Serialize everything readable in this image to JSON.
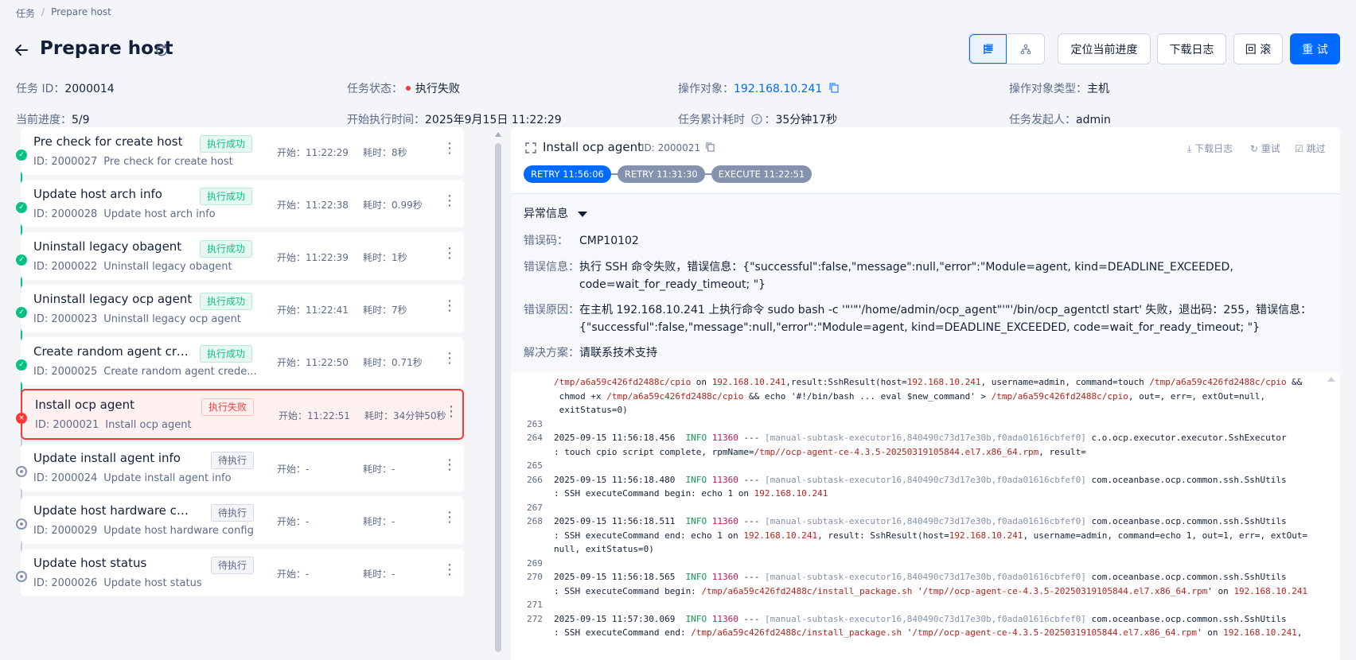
{
  "breadcrumb": {
    "root": "任务",
    "separator": "/",
    "current": "Prepare host"
  },
  "header": {
    "title": "Prepare host"
  },
  "toolbar": {
    "locate_label": "定位当前进度",
    "download_label": "下载日志",
    "rollback_label": "回 滚",
    "retry_label": "重 试"
  },
  "info": {
    "task_id_label": "任务 ID：",
    "task_id": "2000014",
    "status_label": "任务状态：",
    "status": "执行失败",
    "target_label": "操作对象：",
    "target": "192.168.10.241",
    "target_type_label": "操作对象类型：",
    "target_type": "主机",
    "progress_label": "当前进度：",
    "progress": "5/9",
    "start_label": "开始执行时间：",
    "start": "2025年9月15日 11:22:29",
    "elapsed_label": "任务累计耗时",
    "elapsed": "35分钟17秒",
    "initiator_label": "任务发起人：",
    "initiator": "admin"
  },
  "steps": [
    {
      "name": "Pre check for create host",
      "id_line": "ID: 2000027",
      "desc": "Pre check for create host",
      "status": "执行成功",
      "state": "ok",
      "start": "开始：11:22:29",
      "dur": "耗时：8秒"
    },
    {
      "name": "Update host arch info",
      "id_line": "ID: 2000028",
      "desc": "Update host arch info",
      "status": "执行成功",
      "state": "ok",
      "start": "开始：11:22:38",
      "dur": "耗时：0.99秒"
    },
    {
      "name": "Uninstall legacy obagent",
      "id_line": "ID: 2000022",
      "desc": "Uninstall legacy obagent",
      "status": "执行成功",
      "state": "ok",
      "start": "开始：11:22:39",
      "dur": "耗时：1秒"
    },
    {
      "name": "Uninstall legacy ocp agent",
      "id_line": "ID: 2000023",
      "desc": "Uninstall legacy ocp agent",
      "status": "执行成功",
      "state": "ok",
      "start": "开始：11:22:41",
      "dur": "耗时：7秒"
    },
    {
      "name": "Create random agent crede…",
      "id_line": "ID: 2000025",
      "desc": "Create random agent crede...",
      "status": "执行成功",
      "state": "ok",
      "start": "开始：11:22:50",
      "dur": "耗时：0.71秒"
    },
    {
      "name": "Install ocp agent",
      "id_line": "ID: 2000021",
      "desc": "Install ocp agent",
      "status": "执行失败",
      "state": "bad",
      "start": "开始：11:22:51",
      "dur": "耗时：34分钟50秒"
    },
    {
      "name": "Update install agent info",
      "id_line": "ID: 2000024",
      "desc": "Update install agent info",
      "status": "待执行",
      "state": "wait",
      "start": "开始：-",
      "dur": "耗时：-"
    },
    {
      "name": "Update host hardware config",
      "id_line": "ID: 2000029",
      "desc": "Update host hardware config",
      "status": "待执行",
      "state": "wait",
      "start": "开始：-",
      "dur": "耗时：-"
    },
    {
      "name": "Update host status",
      "id_line": "ID: 2000026",
      "desc": "Update host status",
      "status": "待执行",
      "state": "wait",
      "start": "开始：-",
      "dur": "耗时：-"
    }
  ],
  "detail": {
    "title": "Install ocp agent",
    "id": "ID: 2000021",
    "download": "下载日志",
    "retry": "重试",
    "skip": "跳过",
    "runs": [
      "RETRY 11:56:06",
      "RETRY 11:31:30",
      "EXECUTE 11:22:51"
    ],
    "error_section": "异常信息",
    "code_label": "错误码：",
    "code": "CMP10102",
    "msg_label": "错误信息：",
    "msg": "执行 SSH 命令失败，错误信息：{\"successful\":false,\"message\":null,\"error\":\"Module=agent, kind=DEADLINE_EXCEEDED, code=wait_for_ready_timeout; \"}",
    "reason_label": "错误原因：",
    "reason": "在主机 192.168.10.241 上执行命令 sudo bash -c '\"'\"'/home/admin/ocp_agent\"'\"'/bin/ocp_agentctl start' 失败，退出码：255，错误信息：{\"successful\":false,\"message\":null,\"error\":\"Module=agent, kind=DEADLINE_EXCEEDED, code=wait_for_ready_timeout; \"}",
    "solution_label": "解决方案：",
    "solution": "请联系技术支持"
  },
  "log_lines": [
    {
      "n": "",
      "t": "/tmp/a6a59c426fd2488c/cpio on 192.168.10.241,result:SshResult(host=192.168.10.241, username=admin, command=touch /tmp/a6a59c426fd2488c/cpio &&"
    },
    {
      "n": "",
      "t": " chmod +x /tmp/a6a59c426fd2488c/cpio && echo '#!/bin/bash ... eval $new_command' > /tmp/a6a59c426fd2488c/cpio, out=, err=, extOut=null,"
    },
    {
      "n": "",
      "t": " exitStatus=0)"
    },
    {
      "n": "263",
      "t": ""
    },
    {
      "n": "264",
      "t": "2025-09-15 11:56:18.456  INFO 11360 --- [manual-subtask-executor16,840490c73d17e30b,f0ada01616cbfef0] c.o.ocp.executor.executor.SshExecutor"
    },
    {
      "n": "",
      "t": ": touch cpio script complete, rpmName=/tmp//ocp-agent-ce-4.3.5-20250319105844.el7.x86_64.rpm, result="
    },
    {
      "n": "265",
      "t": ""
    },
    {
      "n": "266",
      "t": "2025-09-15 11:56:18.480  INFO 11360 --- [manual-subtask-executor16,840490c73d17e30b,f0ada01616cbfef0] com.oceanbase.ocp.common.ssh.SshUtils"
    },
    {
      "n": "",
      "t": ": SSH executeCommand begin: echo 1 on 192.168.10.241"
    },
    {
      "n": "267",
      "t": ""
    },
    {
      "n": "268",
      "t": "2025-09-15 11:56:18.511  INFO 11360 --- [manual-subtask-executor16,840490c73d17e30b,f0ada01616cbfef0] com.oceanbase.ocp.common.ssh.SshUtils"
    },
    {
      "n": "",
      "t": ": SSH executeCommand end: echo 1 on 192.168.10.241, result: SshResult(host=192.168.10.241, username=admin, command=echo 1, out=1, err=, extOut="
    },
    {
      "n": "",
      "t": "null, exitStatus=0)"
    },
    {
      "n": "269",
      "t": ""
    },
    {
      "n": "270",
      "t": "2025-09-15 11:56:18.565  INFO 11360 --- [manual-subtask-executor16,840490c73d17e30b,f0ada01616cbfef0] com.oceanbase.ocp.common.ssh.SshUtils"
    },
    {
      "n": "",
      "t": ": SSH executeCommand begin: /tmp/a6a59c426fd2488c/install_package.sh '/tmp//ocp-agent-ce-4.3.5-20250319105844.el7.x86_64.rpm' on 192.168.10.241"
    },
    {
      "n": "271",
      "t": ""
    },
    {
      "n": "272",
      "t": "2025-09-15 11:57:30.069  INFO 11360 --- [manual-subtask-executor16,840490c73d17e30b,f0ada01616cbfef0] com.oceanbase.ocp.common.ssh.SshUtils"
    },
    {
      "n": "",
      "t": ": SSH executeCommand end: /tmp/a6a59c426fd2488c/install_package.sh '/tmp//ocp-agent-ce-4.3.5-20250319105844.el7.x86_64.rpm' on 192.168.10.241,"
    }
  ],
  "colors": {
    "primary": "#006aff",
    "success": "#0ac185",
    "danger": "#f93939",
    "muted": "#8592ad"
  },
  "icons": [
    "back-arrow-icon",
    "refresh-icon",
    "list-view-icon",
    "tree-view-icon",
    "copy-icon",
    "help-circle-icon",
    "expand-icon",
    "download-icon",
    "retry-icon",
    "skip-icon",
    "more-icon"
  ]
}
